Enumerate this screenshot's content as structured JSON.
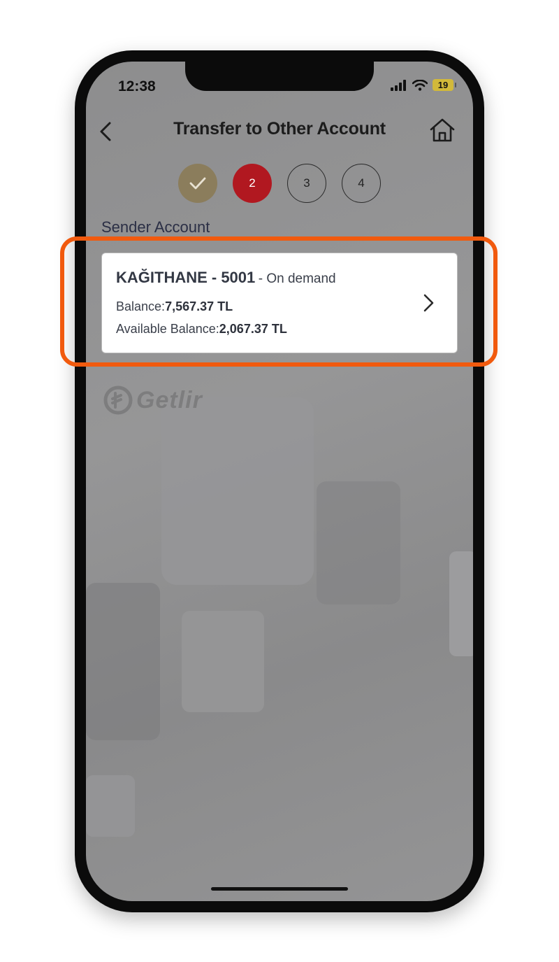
{
  "status_bar": {
    "time": "12:38",
    "battery": "19"
  },
  "nav": {
    "title": "Transfer to Other Account"
  },
  "steps": [
    {
      "label": "✓",
      "state": "done"
    },
    {
      "label": "2",
      "state": "active"
    },
    {
      "label": "3",
      "state": "pending"
    },
    {
      "label": "4",
      "state": "pending"
    }
  ],
  "section": {
    "sender_label": "Sender Account"
  },
  "account_card": {
    "name": "KAĞITHANE - 5001",
    "type": "- On demand",
    "balance_label": "Balance:",
    "balance_value": "7,567.37 TL",
    "available_label": "Available Balance:",
    "available_value": "2,067.37 TL"
  },
  "brand": {
    "logo_text": "Getlir"
  },
  "colors": {
    "highlight": "#f15a0e",
    "step_done": "#8b7d5c",
    "step_active": "#b11820",
    "battery": "#d2b93a"
  }
}
